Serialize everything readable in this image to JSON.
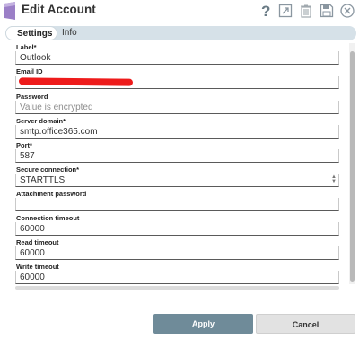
{
  "window": {
    "title": "Edit Account",
    "icons": [
      "help-icon",
      "export-icon",
      "delete-icon",
      "save-icon",
      "close-icon"
    ]
  },
  "tabs": [
    {
      "label": "Settings",
      "active": true
    },
    {
      "label": "Info",
      "active": false
    }
  ],
  "fields": [
    {
      "label": "Label*",
      "value": "Outlook"
    },
    {
      "label": "Email ID",
      "value": ""
    },
    {
      "label": "Password",
      "placeholder": "Value is encrypted"
    },
    {
      "label": "Server domain*",
      "value": "smtp.office365.com"
    },
    {
      "label": "Port*",
      "value": "587"
    },
    {
      "label": "Secure connection*",
      "value": "STARTTLS"
    },
    {
      "label": "Attachment password",
      "value": ""
    },
    {
      "label": "Connection timeout",
      "value": "60000"
    },
    {
      "label": "Read timeout",
      "value": "60000"
    },
    {
      "label": "Write timeout",
      "value": "60000"
    }
  ],
  "buttons": {
    "apply": "Apply",
    "cancel": "Cancel"
  },
  "colors": {
    "accent": "#6f8b99",
    "redaction": "#ee1b1b",
    "logo": "#9b7fc7"
  }
}
